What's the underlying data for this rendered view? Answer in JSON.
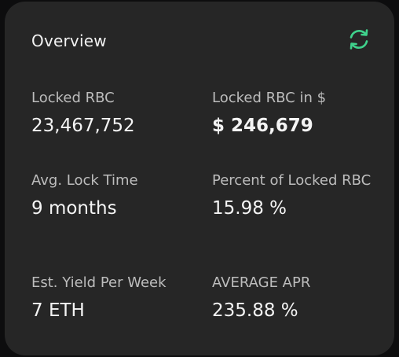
{
  "card": {
    "title": "Overview",
    "refresh_icon": "refresh-icon",
    "accent_color": "#3fd28c"
  },
  "stats": {
    "locked_rbc": {
      "label": "Locked RBC",
      "value": "23,467,752"
    },
    "locked_rbc_usd": {
      "label": "Locked RBC in $",
      "value": "$ 246,679"
    },
    "avg_lock_time": {
      "label": "Avg. Lock Time",
      "value": "9 months"
    },
    "percent_locked": {
      "label": "Percent of Locked RBC",
      "value": "15.98 %"
    },
    "est_yield": {
      "label": "Est. Yield Per Week",
      "value": "7 ETH"
    },
    "average_apr": {
      "label": "AVERAGE APR",
      "value": "235.88 %"
    }
  }
}
